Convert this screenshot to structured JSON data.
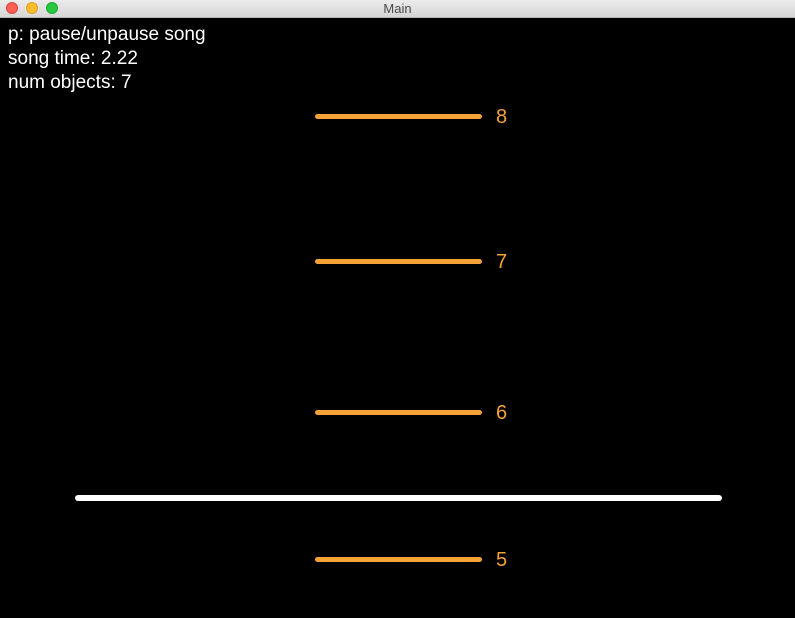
{
  "window": {
    "title": "Main"
  },
  "hud": {
    "pause_hint": "p: pause/unpause song",
    "song_time": "song time: 2.22",
    "num_objects": "num objects: 7"
  },
  "notes": [
    {
      "label": "8"
    },
    {
      "label": "7"
    },
    {
      "label": "6"
    },
    {
      "label": "5"
    }
  ],
  "colors": {
    "note": "#f5a236",
    "hit_line": "#ffffff",
    "background": "#000000"
  }
}
